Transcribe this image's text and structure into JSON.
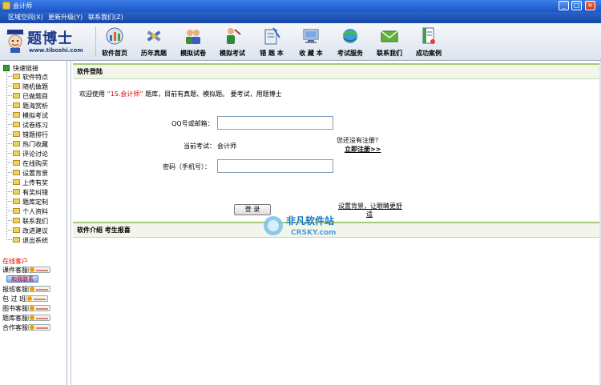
{
  "window": {
    "title": "会计师",
    "minimize_glyph": "_",
    "maximize_glyph": "□",
    "close_glyph": "×"
  },
  "menu": {
    "items": [
      "区域空间(X)",
      "更新升级(Y)",
      "联系我们(Z)"
    ]
  },
  "logo": {
    "brand": "题博士",
    "url": "www.tiboshi.com"
  },
  "toolbar": {
    "items": [
      {
        "label": "软件首页",
        "icon": "home-chart-icon"
      },
      {
        "label": "历年真题",
        "icon": "tools-icon"
      },
      {
        "label": "模拟试卷",
        "icon": "people-icon"
      },
      {
        "label": "模拟考试",
        "icon": "exam-person-icon"
      },
      {
        "label": "错 题 本",
        "icon": "wrong-book-icon"
      },
      {
        "label": "收 藏 本",
        "icon": "computer-icon"
      },
      {
        "label": "考试服务",
        "icon": "network-icon"
      },
      {
        "label": "联系我们",
        "icon": "envelope-icon"
      },
      {
        "label": "成功案例",
        "icon": "document-icon"
      }
    ]
  },
  "sidebar": {
    "root_label": "快速链接",
    "items": [
      "软件特点",
      "随机做题",
      "已做题目",
      "题海赏析",
      "模拟考试",
      "试卷练习",
      "错题排行",
      "热门收藏",
      "评论讨论",
      "在线购买",
      "设置背景",
      "上传有奖",
      "有奖纠错",
      "题库定制",
      "个人资料",
      "联系我们",
      "改进建议",
      "退出系统"
    ],
    "online_title": "在线客户",
    "contact_label": "和我联系",
    "services": [
      "课件客服",
      "报班客服",
      "包 过 班",
      "图书客服",
      "题库客服",
      "合作客服"
    ]
  },
  "main": {
    "section_title": "软件登陆",
    "welcome_prefix": "欢迎使用",
    "welcome_product": "“1S.会计师”",
    "welcome_suffix": "题库，目前有真题、模拟题。 要考试，用题博士",
    "qq_label": "QQ号或邮箱：",
    "qq_value": "",
    "no_account_text": "您还没有注册？",
    "register_link": "立即注册>>",
    "exam_label": "当前考试：",
    "exam_value": "会计师",
    "password_label": "密码（手机号）：",
    "password_value": "",
    "login_button": "登 录",
    "bg_link_line1": "设置背景，让眼睛更舒",
    "bg_link_line2": "适",
    "intro_bar": "软件介绍  考生报喜"
  },
  "watermark": {
    "line1": "非凡软件站",
    "line2": "CRSKY.com"
  },
  "colors": {
    "title_bar": "#1a56c8",
    "menu_bar": "#2a62c8",
    "highlight_red": "#e00000",
    "section_border": "#a8c878"
  }
}
